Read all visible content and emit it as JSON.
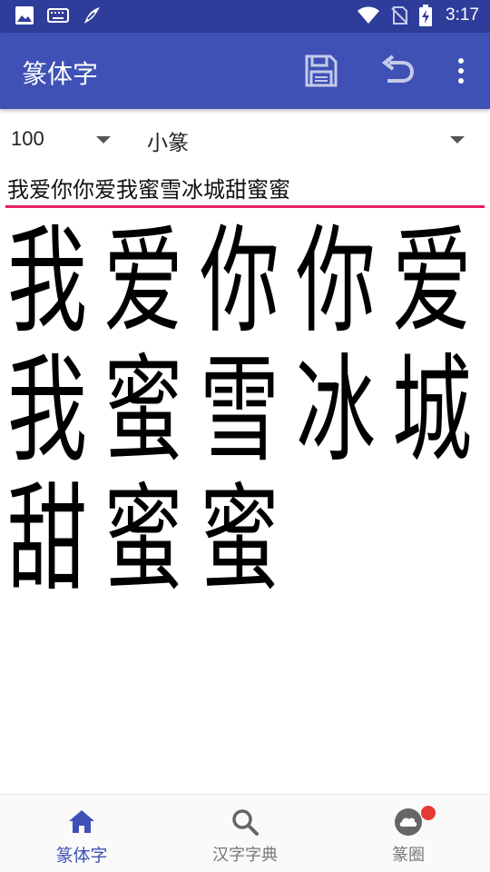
{
  "status_bar": {
    "time": "3:17",
    "icons": [
      "image-icon",
      "keyboard-icon",
      "app-bird-icon",
      "wifi-icon",
      "no-sim-icon",
      "battery-charging-icon"
    ]
  },
  "app_bar": {
    "title": "篆体字",
    "actions": [
      "save-icon",
      "undo-icon",
      "overflow-menu-icon"
    ]
  },
  "controls": {
    "size_value": "100",
    "font_value": "小篆"
  },
  "input": {
    "value": "我爱你你爱我蜜雪冰城甜蜜蜜"
  },
  "glyphs": [
    "我",
    "爱",
    "你",
    "你",
    "爱",
    "我",
    "蜜",
    "雪",
    "冰",
    "城",
    "甜",
    "蜜",
    "蜜"
  ],
  "bottom_nav": {
    "items": [
      {
        "label": "篆体字",
        "icon": "home-icon",
        "active": true
      },
      {
        "label": "汉字字典",
        "icon": "search-icon",
        "active": false
      },
      {
        "label": "篆圈",
        "icon": "cloud-icon",
        "active": false,
        "badge": true
      }
    ]
  },
  "colors": {
    "status_bar": "#2f3d9a",
    "app_bar": "#3f51b5",
    "accent": "#e91e63",
    "nav_active": "#3f51b5",
    "badge": "#e53935"
  }
}
